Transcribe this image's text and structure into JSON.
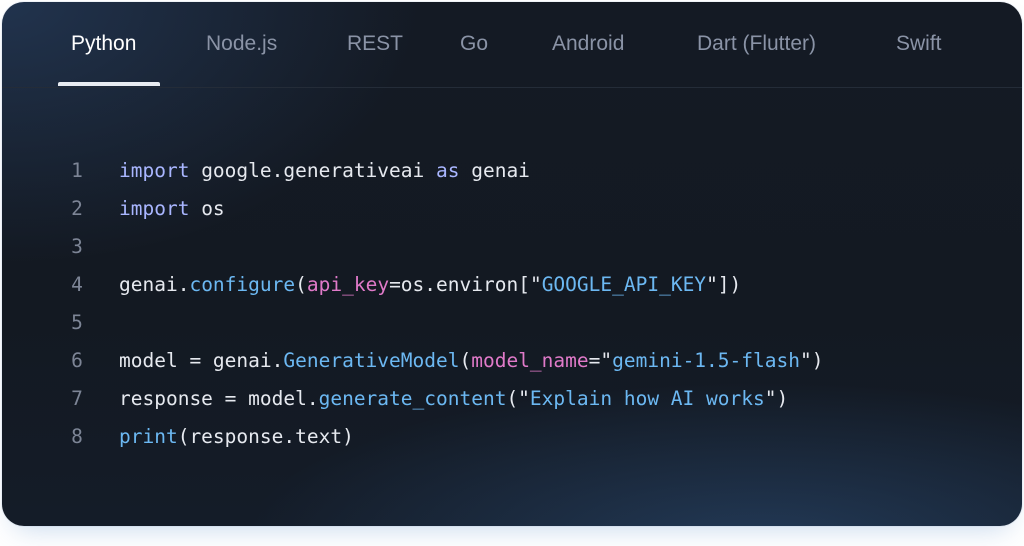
{
  "tabs": [
    {
      "label": "Python",
      "active": true
    },
    {
      "label": "Node.js",
      "active": false
    },
    {
      "label": "REST",
      "active": false
    },
    {
      "label": "Go",
      "active": false
    },
    {
      "label": "Android",
      "active": false
    },
    {
      "label": "Dart (Flutter)",
      "active": false
    },
    {
      "label": "Swift",
      "active": false
    }
  ],
  "code": {
    "language": "Python",
    "lines": [
      {
        "number": "1",
        "tokens": [
          {
            "t": "import",
            "k": "kw"
          },
          {
            "t": " google.generativeai ",
            "k": "plain"
          },
          {
            "t": "as",
            "k": "kw"
          },
          {
            "t": " genai",
            "k": "plain"
          }
        ]
      },
      {
        "number": "2",
        "tokens": [
          {
            "t": "import",
            "k": "kw"
          },
          {
            "t": " os",
            "k": "plain"
          }
        ]
      },
      {
        "number": "3",
        "tokens": []
      },
      {
        "number": "4",
        "tokens": [
          {
            "t": "genai.",
            "k": "plain"
          },
          {
            "t": "configure",
            "k": "fn"
          },
          {
            "t": "(",
            "k": "plain"
          },
          {
            "t": "api_key",
            "k": "param"
          },
          {
            "t": "=os.environ[\"",
            "k": "plain"
          },
          {
            "t": "GOOGLE_API_KEY",
            "k": "str"
          },
          {
            "t": "\"])",
            "k": "plain"
          }
        ]
      },
      {
        "number": "5",
        "tokens": []
      },
      {
        "number": "6",
        "tokens": [
          {
            "t": "model = genai.",
            "k": "plain"
          },
          {
            "t": "GenerativeModel",
            "k": "fn"
          },
          {
            "t": "(",
            "k": "plain"
          },
          {
            "t": "model_name",
            "k": "param"
          },
          {
            "t": "=\"",
            "k": "plain"
          },
          {
            "t": "gemini-1.5-flash",
            "k": "str"
          },
          {
            "t": "\")",
            "k": "plain"
          }
        ]
      },
      {
        "number": "7",
        "tokens": [
          {
            "t": "response = model.",
            "k": "plain"
          },
          {
            "t": "generate_content",
            "k": "fn"
          },
          {
            "t": "(\"",
            "k": "plain"
          },
          {
            "t": "Explain how AI works",
            "k": "str"
          },
          {
            "t": "\")",
            "k": "plain"
          }
        ]
      },
      {
        "number": "8",
        "tokens": [
          {
            "t": "print",
            "k": "fn"
          },
          {
            "t": "(response.text)",
            "k": "plain"
          }
        ]
      }
    ]
  },
  "colors": {
    "background": "#141a24",
    "tab_active": "#ffffff",
    "tab_inactive": "#8a93a6",
    "keyword": "#a9b6ff",
    "function": "#6cb8f2",
    "parameter": "#e07ac9",
    "string": "#6cb8f2",
    "line_number": "#7d8596",
    "text": "#e6e9ef"
  }
}
